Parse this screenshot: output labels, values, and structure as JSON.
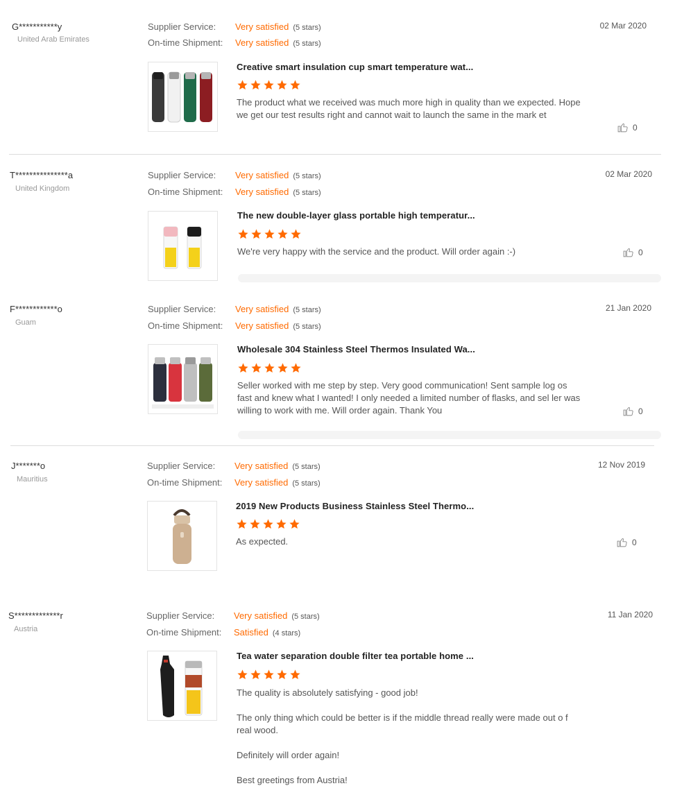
{
  "labels": {
    "supplier_service": "Supplier Service:",
    "shipment": "On-time Shipment:"
  },
  "colors": {
    "accent": "#ff6a00",
    "divider": "#dcdcdc"
  },
  "reviews": [
    {
      "buyer": "G***********y",
      "country": "United Arab Emirates",
      "supplier_value": "Very satisfied",
      "supplier_stars": "(5 stars)",
      "shipment_value": "Very satisfied",
      "shipment_stars": "(5 stars)",
      "date": "02 Mar 2020",
      "product_title": "Creative smart insulation cup smart temperature wat...",
      "rating": 5,
      "text": [
        "The  product what we received was much more high in quality than we expected. Hope we get our test results right and cannot wait to launch the same in the mark et"
      ],
      "likes": "0",
      "image_icon": "four-insulation-cups-image"
    },
    {
      "buyer": "T***************a",
      "country": "United Kingdom",
      "supplier_value": "Very satisfied",
      "supplier_stars": "(5 stars)",
      "shipment_value": "Very satisfied",
      "shipment_stars": "(5 stars)",
      "date": "02 Mar 2020",
      "product_title": "The new double-layer glass portable high temperatur...",
      "rating": 5,
      "text": [
        "We're very happy with the service and the product. Will order again :-)"
      ],
      "likes": "0",
      "image_icon": "two-glass-bottles-image"
    },
    {
      "buyer": "F************o",
      "country": "Guam",
      "supplier_value": "Very satisfied",
      "supplier_stars": "(5 stars)",
      "shipment_value": "Very satisfied",
      "shipment_stars": "(5 stars)",
      "date": "21 Jan 2020",
      "product_title": "Wholesale 304 Stainless Steel Thermos Insulated Wa...",
      "rating": 5,
      "text": [
        "Seller worked with me step by step.  Very good communication!   Sent sample log os fast and knew what I wanted!  I only needed a limited number of flasks, and sel ler was willing to work with me.   Will order again.   Thank You"
      ],
      "likes": "0",
      "image_icon": "four-thermos-flasks-image"
    },
    {
      "buyer": "J*******o",
      "country": "Mauritius",
      "supplier_value": "Very satisfied",
      "supplier_stars": "(5 stars)",
      "shipment_value": "Very satisfied",
      "shipment_stars": "(5 stars)",
      "date": "12 Nov 2019",
      "product_title": "2019 New Products Business Stainless Steel Thermo...",
      "rating": 5,
      "text": [
        "As expected."
      ],
      "likes": "0",
      "image_icon": "gold-thermos-bottle-image"
    },
    {
      "buyer": "S*************r",
      "country": "Austria",
      "supplier_value": "Very satisfied",
      "supplier_stars": "(5 stars)",
      "shipment_value": "Satisfied",
      "shipment_stars": "(4 stars)",
      "date": "11 Jan 2020",
      "product_title": "Tea water separation double filter tea portable home ...",
      "rating": 5,
      "text": [
        "The quality is absolutely satisfying - good job!",
        "The only thing which could be better is if the middle thread really were made out o f real wood.",
        "Definitely will order again!",
        "Best greetings from Austria!"
      ],
      "likes": "",
      "image_icon": "tea-bottle-with-sleeve-image"
    }
  ]
}
